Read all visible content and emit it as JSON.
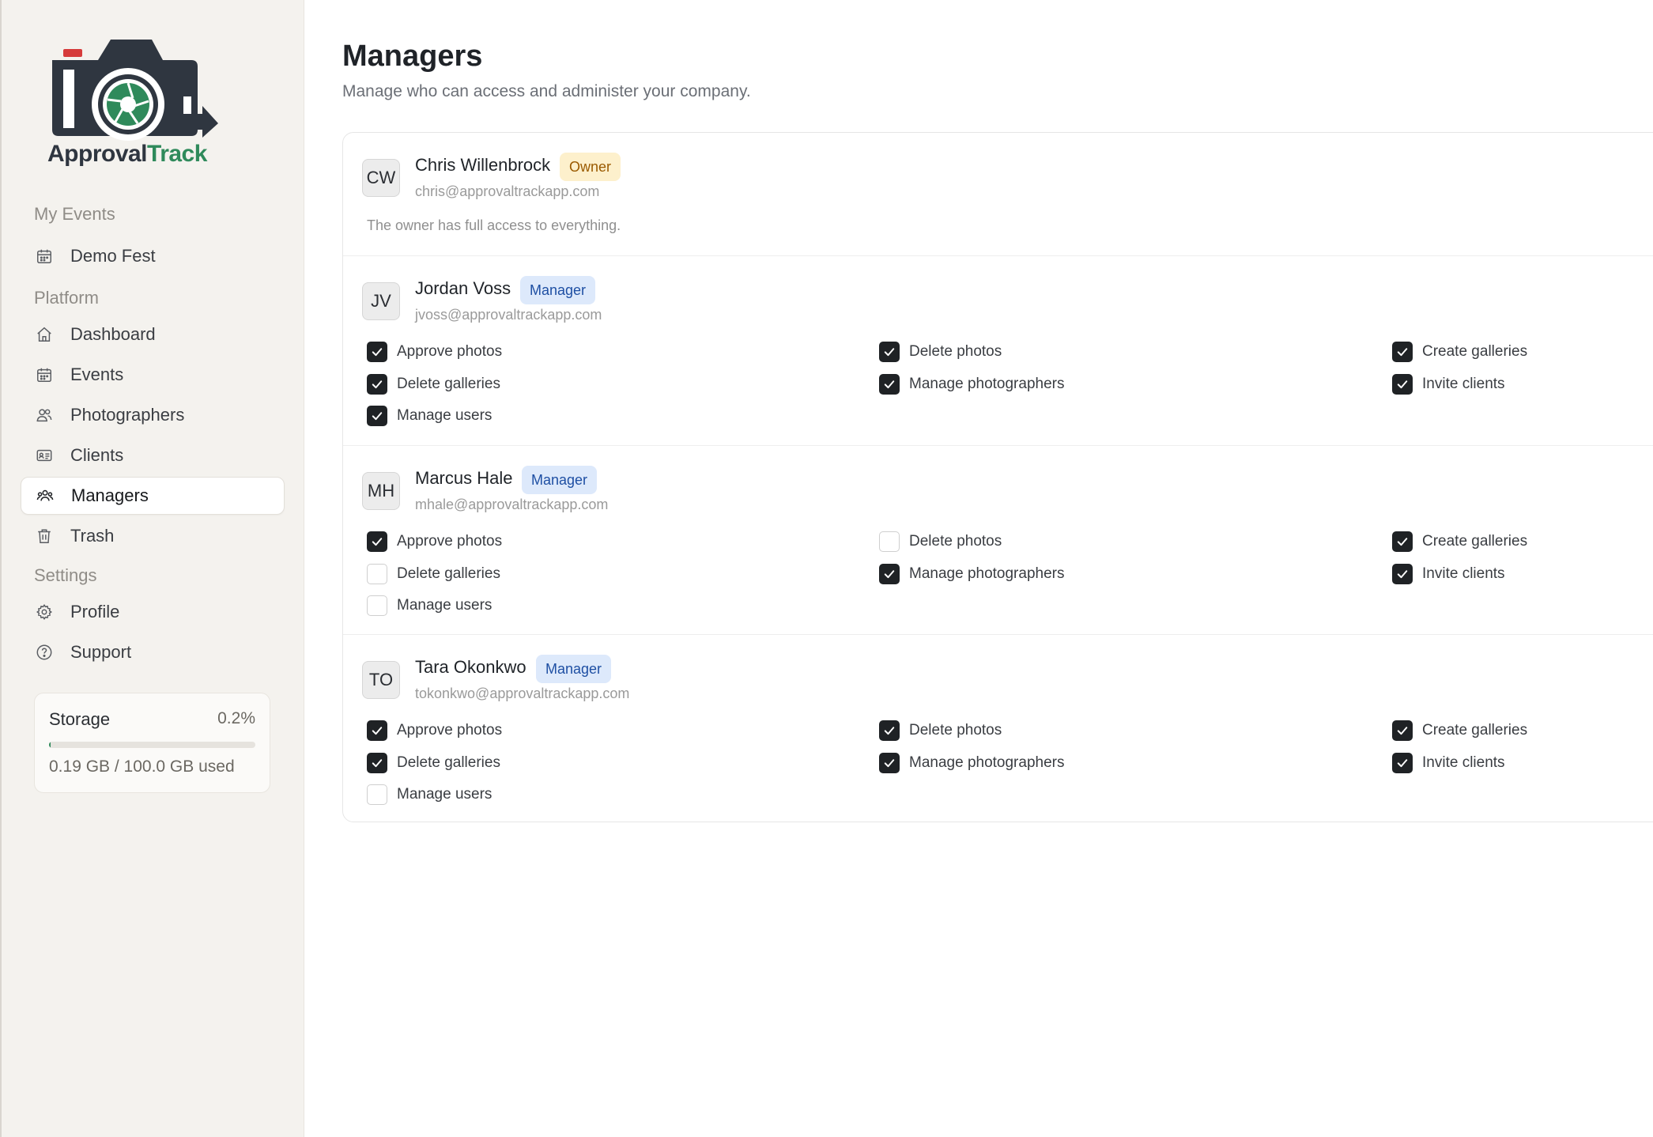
{
  "brand": {
    "part1": "Approval",
    "part2": "Track",
    "accent": "#2f8a5b",
    "dark": "#2f3640",
    "red": "#d63b3b"
  },
  "sidebar": {
    "sections": [
      {
        "title": "My Events",
        "items": [
          {
            "label": "Demo Fest",
            "icon": "calendar-icon"
          }
        ]
      },
      {
        "title": "Platform",
        "items": [
          {
            "label": "Dashboard",
            "icon": "home-icon"
          },
          {
            "label": "Events",
            "icon": "calendar-icon"
          },
          {
            "label": "Photographers",
            "icon": "users-icon"
          },
          {
            "label": "Clients",
            "icon": "id-card-icon"
          },
          {
            "label": "Managers",
            "icon": "team-icon",
            "active": true
          },
          {
            "label": "Trash",
            "icon": "trash-icon"
          }
        ]
      },
      {
        "title": "Settings",
        "items": [
          {
            "label": "Profile",
            "icon": "gear-icon"
          },
          {
            "label": "Support",
            "icon": "help-circle-icon"
          }
        ]
      }
    ],
    "storage": {
      "title": "Storage",
      "percent": "0.2%",
      "fraction": 0.002,
      "used": "0.19 GB / 100.0 GB used"
    }
  },
  "page": {
    "title": "Managers",
    "subtitle": "Manage who can access and administer your company."
  },
  "members": [
    {
      "initials": "CW",
      "name": "Chris Willenbrock",
      "role": "Owner",
      "email": "chris@approvaltrackapp.com",
      "note": "The owner has full access to everything."
    },
    {
      "initials": "JV",
      "name": "Jordan Voss",
      "role": "Manager",
      "email": "jvoss@approvaltrackapp.com",
      "permissions": [
        {
          "label": "Approve photos",
          "checked": true
        },
        {
          "label": "Delete photos",
          "checked": true
        },
        {
          "label": "Create galleries",
          "checked": true
        },
        {
          "label": "Delete galleries",
          "checked": true
        },
        {
          "label": "Manage photographers",
          "checked": true
        },
        {
          "label": "Invite clients",
          "checked": true
        },
        {
          "label": "Manage users",
          "checked": true
        }
      ]
    },
    {
      "initials": "MH",
      "name": "Marcus Hale",
      "role": "Manager",
      "email": "mhale@approvaltrackapp.com",
      "permissions": [
        {
          "label": "Approve photos",
          "checked": true
        },
        {
          "label": "Delete photos",
          "checked": false
        },
        {
          "label": "Create galleries",
          "checked": true
        },
        {
          "label": "Delete galleries",
          "checked": false
        },
        {
          "label": "Manage photographers",
          "checked": true
        },
        {
          "label": "Invite clients",
          "checked": true
        },
        {
          "label": "Manage users",
          "checked": false
        }
      ]
    },
    {
      "initials": "TO",
      "name": "Tara Okonkwo",
      "role": "Manager",
      "email": "tokonkwo@approvaltrackapp.com",
      "permissions": [
        {
          "label": "Approve photos",
          "checked": true
        },
        {
          "label": "Delete photos",
          "checked": true
        },
        {
          "label": "Create galleries",
          "checked": true
        },
        {
          "label": "Delete galleries",
          "checked": true
        },
        {
          "label": "Manage photographers",
          "checked": true
        },
        {
          "label": "Invite clients",
          "checked": true
        },
        {
          "label": "Manage users",
          "checked": false
        }
      ]
    }
  ]
}
